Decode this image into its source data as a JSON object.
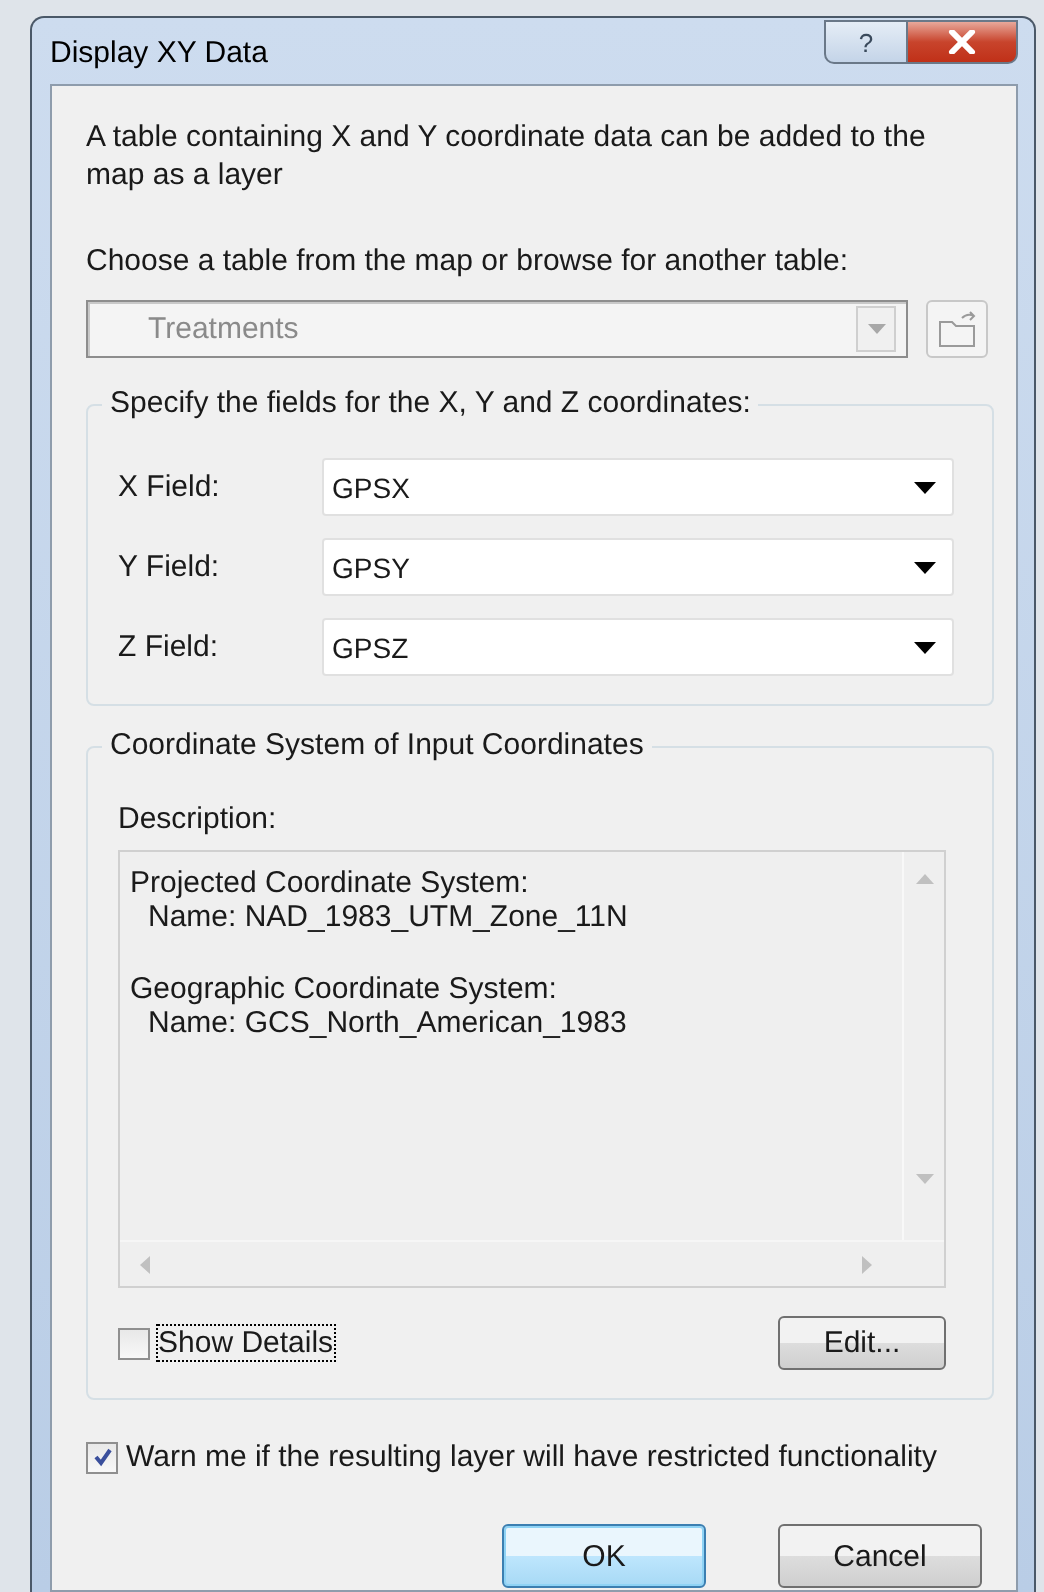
{
  "window": {
    "title": "Display XY Data",
    "buttons": [
      {
        "kind": "help",
        "label": "?"
      },
      {
        "kind": "close"
      }
    ]
  },
  "intro": "A table containing X and Y coordinate data can be added to the map as a layer",
  "table_chooser": {
    "label": "Choose a table from the map or browse for another table:",
    "value": "Treatments",
    "disabled": true
  },
  "fields_group": {
    "title": "Specify the fields for the X, Y and Z coordinates:",
    "fields": [
      {
        "label": "X Field:",
        "value": "GPSX"
      },
      {
        "label": "Y Field:",
        "value": "GPSY"
      },
      {
        "label": "Z Field:",
        "value": "GPSZ"
      }
    ]
  },
  "coordinate_group": {
    "title": "Coordinate System of Input Coordinates",
    "description_label": "Description:",
    "description": [
      {
        "title": "Projected Coordinate System:",
        "detail": "Name: NAD_1983_UTM_Zone_11N"
      },
      {
        "title": "Geographic Coordinate System:",
        "detail": "Name: GCS_North_American_1983"
      }
    ],
    "show_details": {
      "label": "Show Details",
      "checked": false
    },
    "edit_button": "Edit..."
  },
  "warn": {
    "label": "Warn me if the resulting layer will have restricted functionality",
    "checked": true
  },
  "buttons": [
    {
      "label": "OK",
      "default": true
    },
    {
      "label": "Cancel",
      "default": false
    }
  ]
}
